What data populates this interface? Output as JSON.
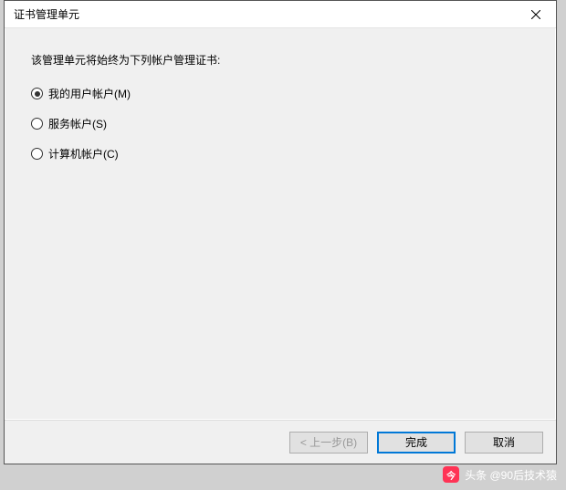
{
  "dialog": {
    "title": "证书管理单元",
    "prompt": "该管理单元将始终为下列帐户管理证书:",
    "options": [
      {
        "label": "我的用户帐户(M)",
        "selected": true
      },
      {
        "label": "服务帐户(S)",
        "selected": false
      },
      {
        "label": "计算机帐户(C)",
        "selected": false
      }
    ],
    "buttons": {
      "back": "< 上一步(B)",
      "finish": "完成",
      "cancel": "取消"
    }
  },
  "watermark": {
    "text": "头条 @90后技术猿",
    "icon_label": "头条"
  }
}
